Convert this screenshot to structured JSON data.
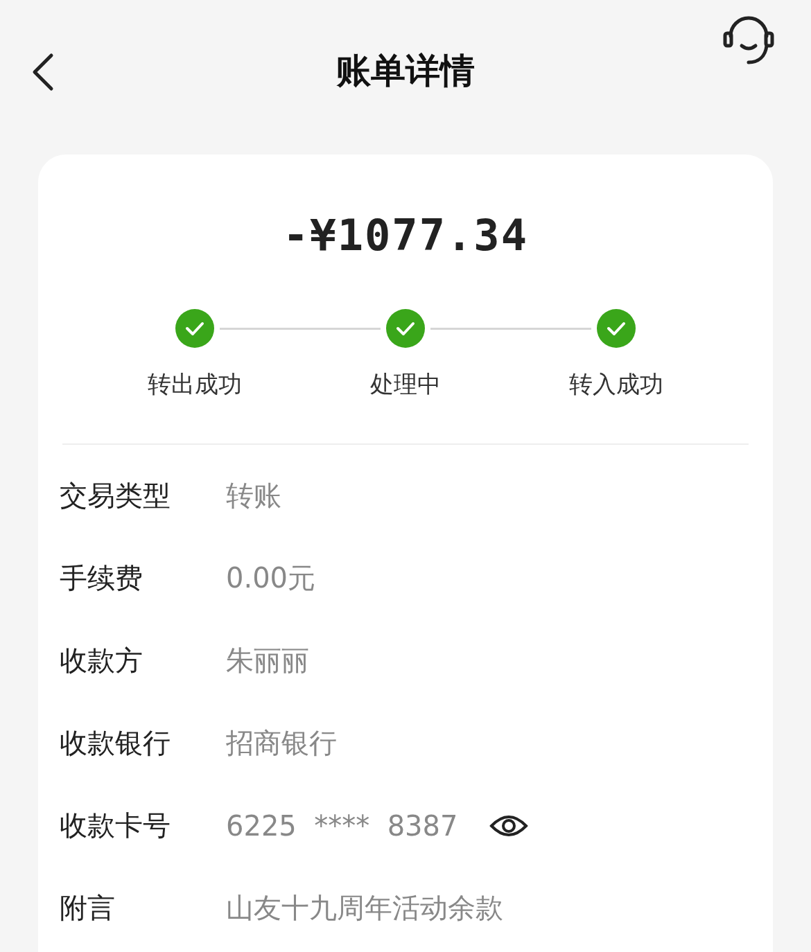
{
  "header": {
    "title": "账单详情"
  },
  "amount": "-¥1077.34",
  "steps": [
    {
      "label": "转出成功",
      "done": true
    },
    {
      "label": "处理中",
      "done": true
    },
    {
      "label": "转入成功",
      "done": true
    }
  ],
  "details": [
    {
      "kind": "text",
      "label": "交易类型",
      "value": "转账"
    },
    {
      "kind": "text",
      "label": "手续费",
      "value": "0.00元"
    },
    {
      "kind": "text",
      "label": "收款方",
      "value": "朱丽丽"
    },
    {
      "kind": "text",
      "label": "收款银行",
      "value": "招商银行"
    },
    {
      "kind": "masked",
      "label": "收款卡号",
      "value": "6225  ****  8387"
    },
    {
      "kind": "text",
      "label": "附言",
      "value": "山友十九周年活动余款"
    }
  ]
}
